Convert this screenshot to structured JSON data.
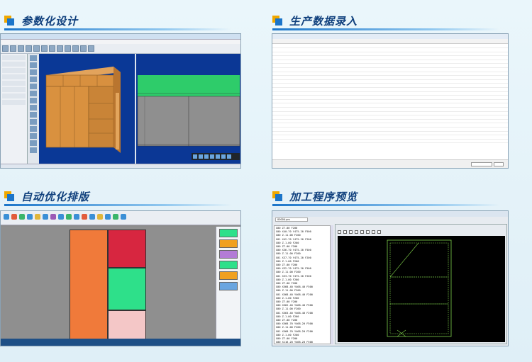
{
  "panels": {
    "design": {
      "title": "参数化设计"
    },
    "data_entry": {
      "title": "生产数据录入",
      "rows": 25
    },
    "optimize": {
      "title": "自动优化排版"
    },
    "program": {
      "title": "加工程序预览",
      "file_value": "00004.prs",
      "code_lines": [
        "G00 Z7.00 F200",
        "G00 X40.70 Y475.20 F500",
        "G00 Z-11.00 F200",
        "G01 X42.70 Y475.20 F200",
        "G00 Z-1.00 F200",
        "G00 Z7.00 F200",
        "G00 X36.70 Y475.20 F500",
        "G00 Z-11.00 F200",
        "G01 X37.70 Y475.20 F200",
        "G00 Z-1.00 F200",
        "G00 Z7.00 F200",
        "G00 X32.70 Y475.20 F500",
        "G00 Z-11.00 F200",
        "G01 X33.70 Y475.20 F200",
        "G00 Z-1.00 F200",
        "G00 Z7.00 F200",
        "G00 X568.40 Y468.40 F500",
        "G00 Z-11.00 F200",
        "G01 X568.40 Y468.40 F200",
        "G00 Z-1.00 F200",
        "G00 Z7.00 F200",
        "G00 X562.40 Y468.40 F500",
        "G00 Z-11.00 F200",
        "G01 X563.40 Y468.40 F200",
        "G00 Z-1.00 F200",
        "G00 Z7.00 F200",
        "G00 X568.70 Y468.20 F500",
        "G00 Z-11.00 F200",
        "G01 X568.70 Y468.20 F200",
        "G00 Z-1.00 F200",
        "G00 Z7.00 F200",
        "G00 X116.20 Y468.20 F500"
      ]
    }
  }
}
